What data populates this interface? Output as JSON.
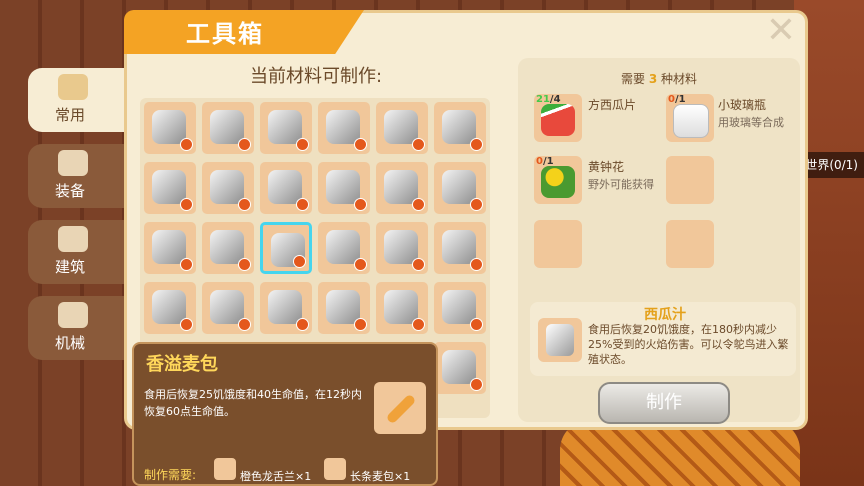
{
  "title": "工具箱",
  "world_badge": "世界(0/1)",
  "tabs": [
    {
      "label": "常用",
      "active": true,
      "icon": "box-icon"
    },
    {
      "label": "装备",
      "active": false,
      "icon": "armor-icon"
    },
    {
      "label": "建筑",
      "active": false,
      "icon": "house-icon"
    },
    {
      "label": "机械",
      "active": false,
      "icon": "gear-icon"
    }
  ],
  "subtitle": "当前材料可制作:",
  "grid_items": [
    "bed",
    "blackboard",
    "bucket",
    "axe",
    "pizza-cutter",
    "pickaxe",
    "drill",
    "shovel",
    "spade",
    "scythe",
    "sickle",
    "torch",
    "scissors",
    "nut-bowl",
    "watermelon-juice",
    "burger",
    "meat-bowl",
    "bread-bun",
    "steak",
    "cheese",
    "baguette",
    "fries",
    "pie",
    "waffle",
    "",
    "",
    "",
    "",
    "",
    "soup-bowl"
  ],
  "selected_index": 14,
  "detail": {
    "name": "香溢麦包",
    "desc": "食用后恢复25饥饿度和40生命值，在12秒内恢复60点生命值。",
    "req_label": "制作需要:",
    "mat1": "橙色龙舌兰×1",
    "mat2": "长条麦包×1"
  },
  "recipe": {
    "need_prefix": "需要",
    "need_count": "3",
    "need_suffix": "种材料",
    "materials": [
      {
        "name": "方西瓜片",
        "sub": "",
        "have": "21",
        "need": "4",
        "enough": true
      },
      {
        "name": "小玻璃瓶",
        "sub": "用玻璃等合成",
        "have": "0",
        "need": "1",
        "enough": false
      },
      {
        "name": "黄钟花",
        "sub": "野外可能获得",
        "have": "0",
        "need": "1",
        "enough": false
      }
    ],
    "result_name": "西瓜汁",
    "result_desc": "食用后恢复20饥饿度，在180秒内减少25%受到的火焰伤害。可以令鸵鸟进入繁殖状态。",
    "make_label": "制作"
  },
  "colors": {
    "accent": "#f4a324",
    "enough": "#46c94a",
    "lack": "#e4581c"
  }
}
